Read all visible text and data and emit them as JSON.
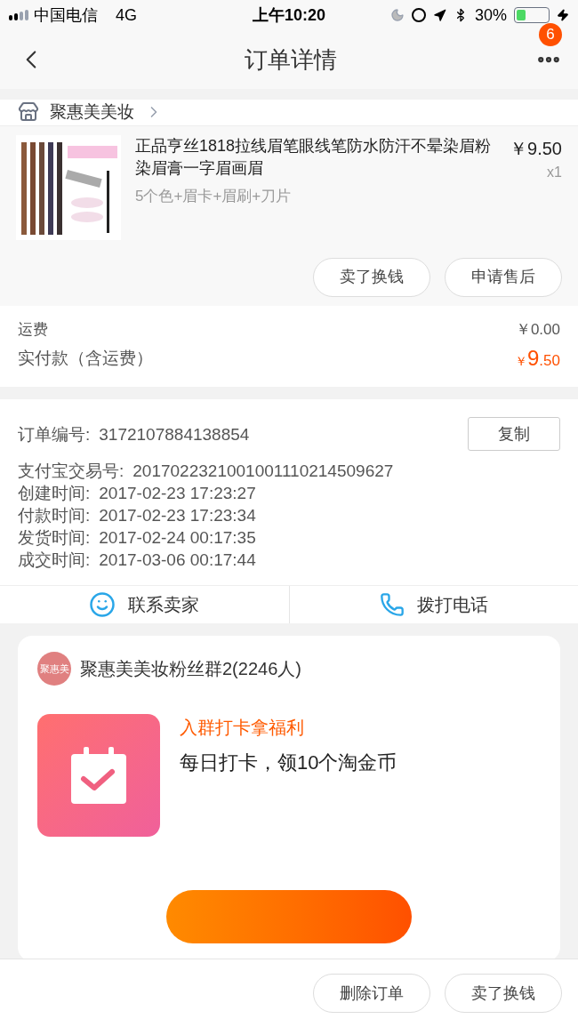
{
  "status_bar": {
    "carrier": "中国电信",
    "network": "4G",
    "time": "上午10:20",
    "battery": "30%"
  },
  "nav": {
    "title": "订单详情",
    "badge": "6"
  },
  "shop": {
    "name": "聚惠美美妆"
  },
  "product": {
    "title": "正品亨丝1818拉线眉笔眼线笔防水防汗不晕染眉粉染眉膏一字眉画眉",
    "sku": "5个色+眉卡+眉刷+刀片",
    "price": "￥9.50",
    "quantity": "x1",
    "buttons": [
      "卖了换钱",
      "申请售后"
    ]
  },
  "fees": [
    {
      "label": "运费",
      "value": "￥0.00",
      "kind": "plain"
    },
    {
      "label": "实付款（含运费）",
      "currency": "￥",
      "integer": "9",
      "decimal": ".50",
      "kind": "total"
    }
  ],
  "order_info": {
    "copy_button": "复制",
    "rows": [
      {
        "label": "订单编号:",
        "value": "3172107884138854"
      },
      {
        "label": "支付宝交易号:",
        "value": "2017022321001001110214509627"
      },
      {
        "label": "创建时间:",
        "value": "2017-02-23 17:23:27"
      },
      {
        "label": "付款时间:",
        "value": "2017-02-23 17:23:34"
      },
      {
        "label": "发货时间:",
        "value": "2017-02-24 00:17:35"
      },
      {
        "label": "成交时间:",
        "value": "2017-03-06 00:17:44"
      }
    ]
  },
  "contact": [
    {
      "label": "联系卖家",
      "kind": "chat"
    },
    {
      "label": "拨打电话",
      "kind": "phone"
    }
  ],
  "group_card": {
    "avatar_text": "聚惠美",
    "name": "聚惠美美妆粉丝群2(2246人)",
    "promo_title": "入群打卡拿福利",
    "promo_text": "每日打卡，领10个淘金币"
  },
  "bottom_bar": {
    "buttons": [
      "删除订单",
      "卖了换钱"
    ]
  }
}
